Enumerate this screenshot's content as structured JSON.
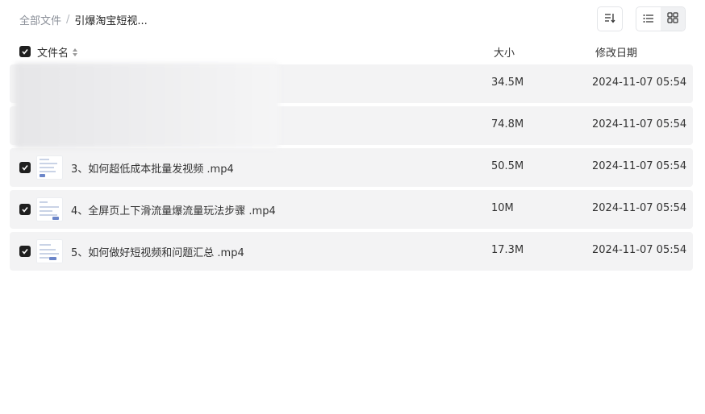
{
  "breadcrumb": {
    "root": "全部文件",
    "separator": "/",
    "current": "引爆淘宝短视..."
  },
  "toolbar": {
    "sort_icon": "sort-icon",
    "list_view_icon": "list-view-icon",
    "grid_view_icon": "grid-view-icon",
    "active_view": "list"
  },
  "table": {
    "headers": {
      "name": "文件名",
      "size": "大小",
      "date": "修改日期"
    },
    "rows": [
      {
        "name": "",
        "size": "34.5M",
        "date": "2024-11-07 05:54",
        "checked": true,
        "redacted": true
      },
      {
        "name": "",
        "size": "74.8M",
        "date": "2024-11-07 05:54",
        "checked": true,
        "redacted": true
      },
      {
        "name": "3、如何超低成本批量发视频 .mp4",
        "size": "50.5M",
        "date": "2024-11-07 05:54",
        "checked": true
      },
      {
        "name": "4、全屏页上下滑流量爆流量玩法步骤 .mp4",
        "size": "10M",
        "date": "2024-11-07 05:54",
        "checked": true
      },
      {
        "name": "5、如何做好短视频和问题汇总 .mp4",
        "size": "17.3M",
        "date": "2024-11-07 05:54",
        "checked": true
      }
    ]
  },
  "colors": {
    "row_bg": "#f3f3f4",
    "checkbox": "#1f1f1f",
    "muted_text": "#8a8f98"
  }
}
